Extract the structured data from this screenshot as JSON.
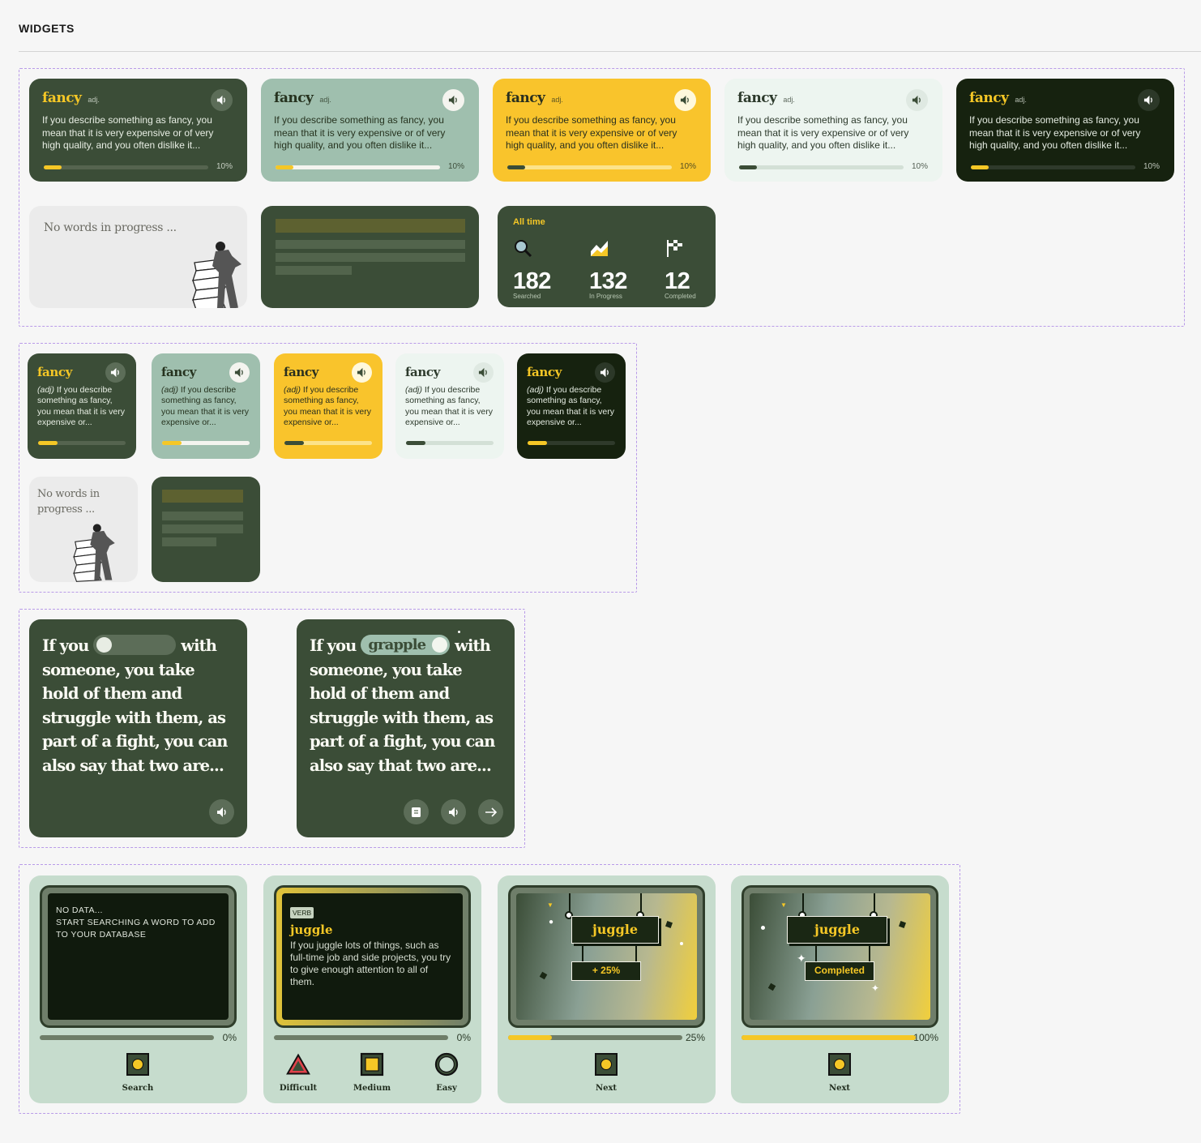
{
  "page": {
    "title": "WIDGETS"
  },
  "colors": {
    "dark_green": "#3b4d37",
    "yellow": "#f5c726",
    "sage": "#9fbfae",
    "mint": "#edf5f0",
    "black_green": "#16220f",
    "light_panel": "#c6dccd"
  },
  "word_cards": {
    "word": "fancy",
    "pos": "adj.",
    "definition": "If you describe something as fancy, you mean that it is very expensive or of very high quality, and you often dislike it...",
    "progress_label": "10%",
    "progress": 0.1,
    "speaker_icon": "speaker-icon"
  },
  "small_word_cards": {
    "word": "fancy",
    "pos": "(adj)",
    "definition": " If you describe something as fancy, you mean that it is very expensive or..."
  },
  "empty_state": {
    "text": "No words in progress ...",
    "text_small_1": "No words in",
    "text_small_2": "progress ..."
  },
  "stats": {
    "label": "All time",
    "items": [
      {
        "value": "182",
        "caption": "Searched",
        "icon": "magnifier-icon"
      },
      {
        "value": "132",
        "caption": "In Progress",
        "icon": "chart-icon"
      },
      {
        "value": "12",
        "caption": "Completed",
        "icon": "flag-icon"
      }
    ]
  },
  "quote_cards": {
    "lead": "If you",
    "rest": "with someone, you take hold of them and struggle with them, as part of a fight, you can also say that two are...",
    "revealed_word": "grapple"
  },
  "game_cards": {
    "empty": {
      "line1": "NO DATA...",
      "line2": "START SEARCHING A WORD TO ADD TO YOUR DATABASE",
      "pct": "0%",
      "button": "Search"
    },
    "word": {
      "tag": "VERB",
      "word": "juggle",
      "definition": "If you juggle lots of things, such as full-time job and side projects, you try to give enough attention to all of them.",
      "pct": "0%",
      "buttons": [
        "Difficult",
        "Medium",
        "Easy"
      ]
    },
    "reward_progress": {
      "word": "juggle",
      "badge": "+ 25%",
      "pct": "25%",
      "progress": 0.25,
      "button": "Next"
    },
    "reward_done": {
      "word": "juggle",
      "badge": "Completed",
      "pct": "100%",
      "progress": 1.0,
      "button": "Next"
    }
  }
}
